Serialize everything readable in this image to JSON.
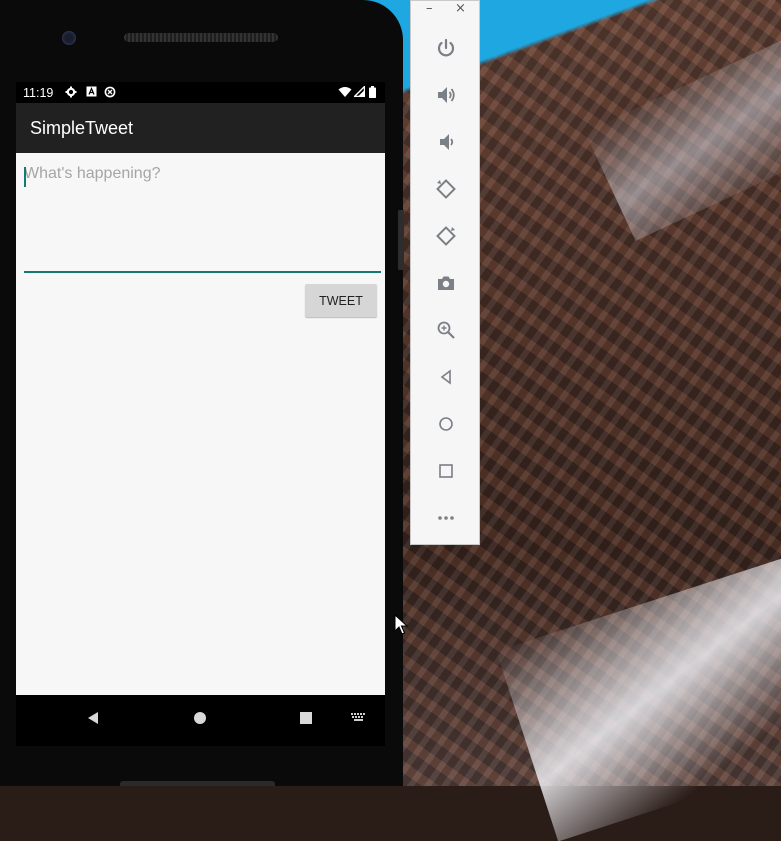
{
  "status_bar": {
    "time": "11:19",
    "icons": [
      "gear-icon",
      "a-box-icon",
      "sync-icon",
      "wifi-icon",
      "signal-icon",
      "battery-icon"
    ]
  },
  "app_bar": {
    "title": "SimpleTweet"
  },
  "compose": {
    "placeholder": "What's happening?",
    "value": "",
    "button_label": "TWEET",
    "accent_color": "#127a72"
  },
  "nav_bar": {
    "icons": [
      "back-icon",
      "home-icon",
      "recents-icon",
      "keyboard-icon"
    ]
  },
  "emulator_toolbar": {
    "window_controls": [
      "–",
      "×"
    ],
    "tools": [
      "power-icon",
      "volume-up-icon",
      "volume-down-icon",
      "rotate-left-icon",
      "rotate-right-icon",
      "camera-icon",
      "zoom-icon",
      "back-icon",
      "home-icon",
      "overview-icon",
      "more-icon"
    ]
  },
  "colors": {
    "app_bar_bg": "#212121",
    "content_bg": "#f7f7f7",
    "button_bg": "#d6d6d6",
    "sky": "#1ea7e1"
  }
}
